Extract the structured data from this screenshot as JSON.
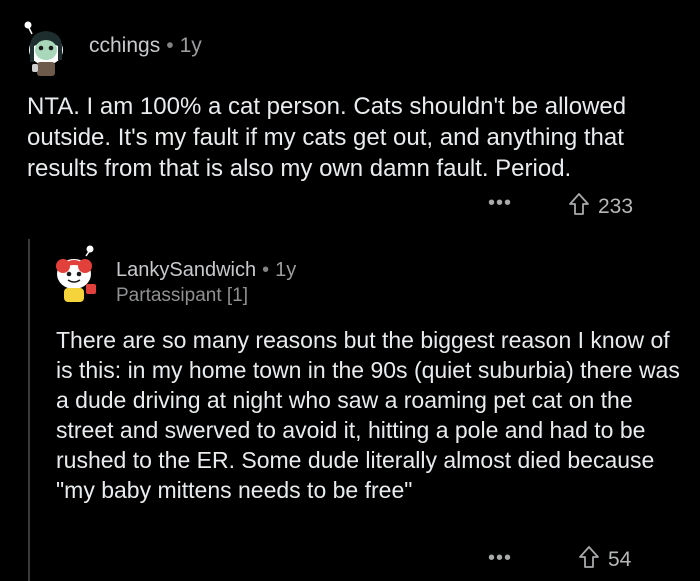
{
  "comment1": {
    "username": "cchings",
    "separator": "•",
    "age": "1y",
    "body": "NTA. I am 100% a cat person. Cats shouldn't be allowed outside. It's my fault if my cats get out, and anything that results from that is also my own damn fault. Period.",
    "more_label": "•••",
    "upvote_icon": "upvote-arrow-icon",
    "vote_count": "233"
  },
  "reply1": {
    "username": "LankySandwich",
    "separator": "•",
    "age": "1y",
    "flair": "Partassipant [1]",
    "body": "There are so many reasons but the biggest reason I know of is this: in my home town in the 90s (quiet suburbia) there was a dude driving at night who saw a roaming pet cat on the street and swerved to avoid it, hitting a pole and had to be rushed to the ER. Some dude literally almost died because \"my baby mittens needs to be free\"",
    "more_label": "•••",
    "upvote_icon": "upvote-arrow-icon",
    "vote_count": "54"
  },
  "colors": {
    "background": "#000000",
    "text": "#e9ecee",
    "meta": "#9a9c9e",
    "thread_line": "#3a3a3c"
  }
}
